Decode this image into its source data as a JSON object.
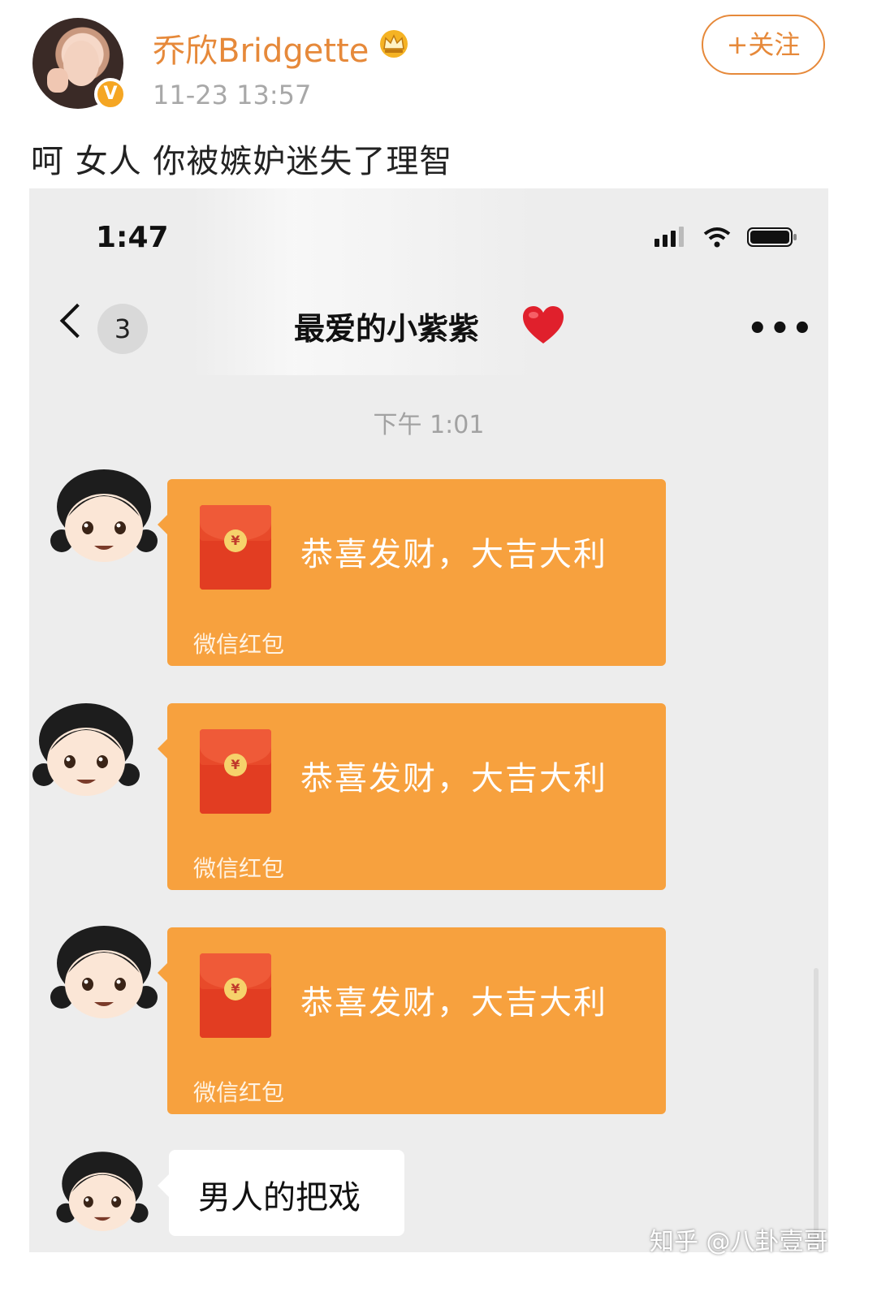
{
  "post": {
    "username": "乔欣Bridgette",
    "timestamp": "11-23 13:57",
    "follow_label": "+关注",
    "text": "呵 女人 你被嫉妒迷失了理智",
    "verified_badge": "V",
    "crown_icon": "crown-icon",
    "accent_color": "#e6893a"
  },
  "screenshot": {
    "status_bar": {
      "time": "1:47",
      "icons": [
        "signal-icon",
        "wifi-icon",
        "battery-icon"
      ]
    },
    "nav": {
      "back_icon": "chevron-left-icon",
      "unread_count": "3",
      "title": "最爱的小紫紫",
      "title_emoji": "heart-icon",
      "more_icon": "more-dots-icon",
      "more_text": "•••"
    },
    "chat_timestamp": "下午 1:01",
    "messages": [
      {
        "type": "red_packet",
        "text": "恭喜发财，大吉大利",
        "label": "微信红包"
      },
      {
        "type": "red_packet",
        "text": "恭喜发财，大吉大利",
        "label": "微信红包"
      },
      {
        "type": "red_packet",
        "text": "恭喜发财，大吉大利",
        "label": "微信红包"
      },
      {
        "type": "text",
        "text": "男人的把戏"
      }
    ],
    "coin_symbol": "¥",
    "red_packet_color": "#f7a13e",
    "envelope_color": "#e84a2a"
  },
  "watermark": "知乎 @八卦壹哥"
}
